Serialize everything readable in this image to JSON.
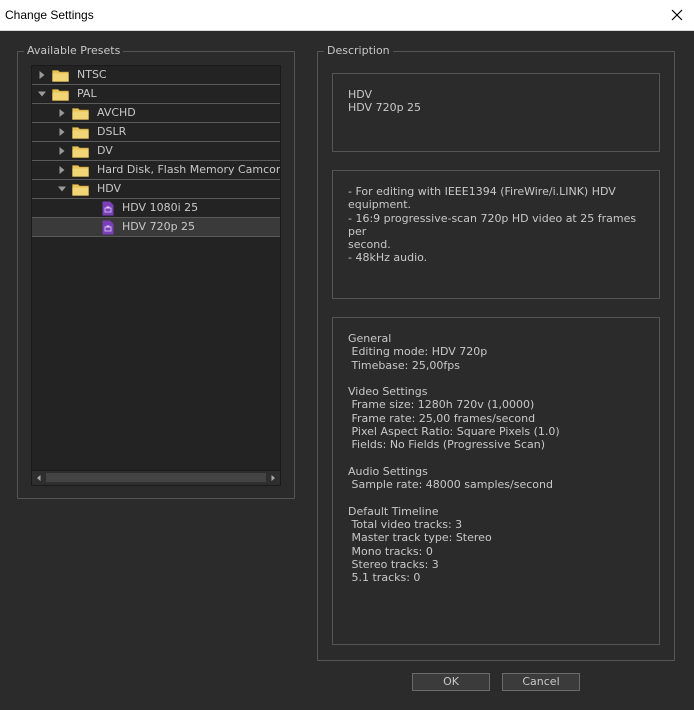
{
  "window": {
    "title": "Change Settings"
  },
  "presets": {
    "label": "Available Presets",
    "items": [
      {
        "label": "NTSC",
        "type": "folder",
        "expanded": false,
        "level": 0
      },
      {
        "label": "PAL",
        "type": "folder",
        "expanded": true,
        "level": 0
      },
      {
        "label": "AVCHD",
        "type": "folder",
        "expanded": false,
        "level": 1
      },
      {
        "label": "DSLR",
        "type": "folder",
        "expanded": false,
        "level": 1
      },
      {
        "label": "DV",
        "type": "folder",
        "expanded": false,
        "level": 1
      },
      {
        "label": "Hard Disk, Flash Memory Camcorders",
        "type": "folder",
        "expanded": false,
        "level": 1
      },
      {
        "label": "HDV",
        "type": "folder",
        "expanded": true,
        "level": 1
      },
      {
        "label": "HDV 1080i 25",
        "type": "preset",
        "level": 2,
        "selected": false
      },
      {
        "label": "HDV 720p 25",
        "type": "preset",
        "level": 2,
        "selected": true
      }
    ]
  },
  "description": {
    "label": "Description",
    "name_text": "HDV\nHDV 720p 25",
    "desc_text": "- For editing with IEEE1394 (FireWire/i.LINK) HDV\nequipment.\n- 16:9 progressive-scan 720p HD video at 25 frames per\nsecond.\n- 48kHz audio.",
    "details_text": "General\n Editing mode: HDV 720p\n Timebase: 25,00fps\n\nVideo Settings\n Frame size: 1280h 720v (1,0000)\n Frame rate: 25,00 frames/second\n Pixel Aspect Ratio: Square Pixels (1.0)\n Fields: No Fields (Progressive Scan)\n\nAudio Settings\n Sample rate: 48000 samples/second\n\nDefault Timeline\n Total video tracks: 3\n Master track type: Stereo\n Mono tracks: 0\n Stereo tracks: 3\n 5.1 tracks: 0"
  },
  "buttons": {
    "ok": "OK",
    "cancel": "Cancel"
  },
  "colors": {
    "folder": "#e8c45a",
    "preset_icon": "#7b3fb8"
  }
}
